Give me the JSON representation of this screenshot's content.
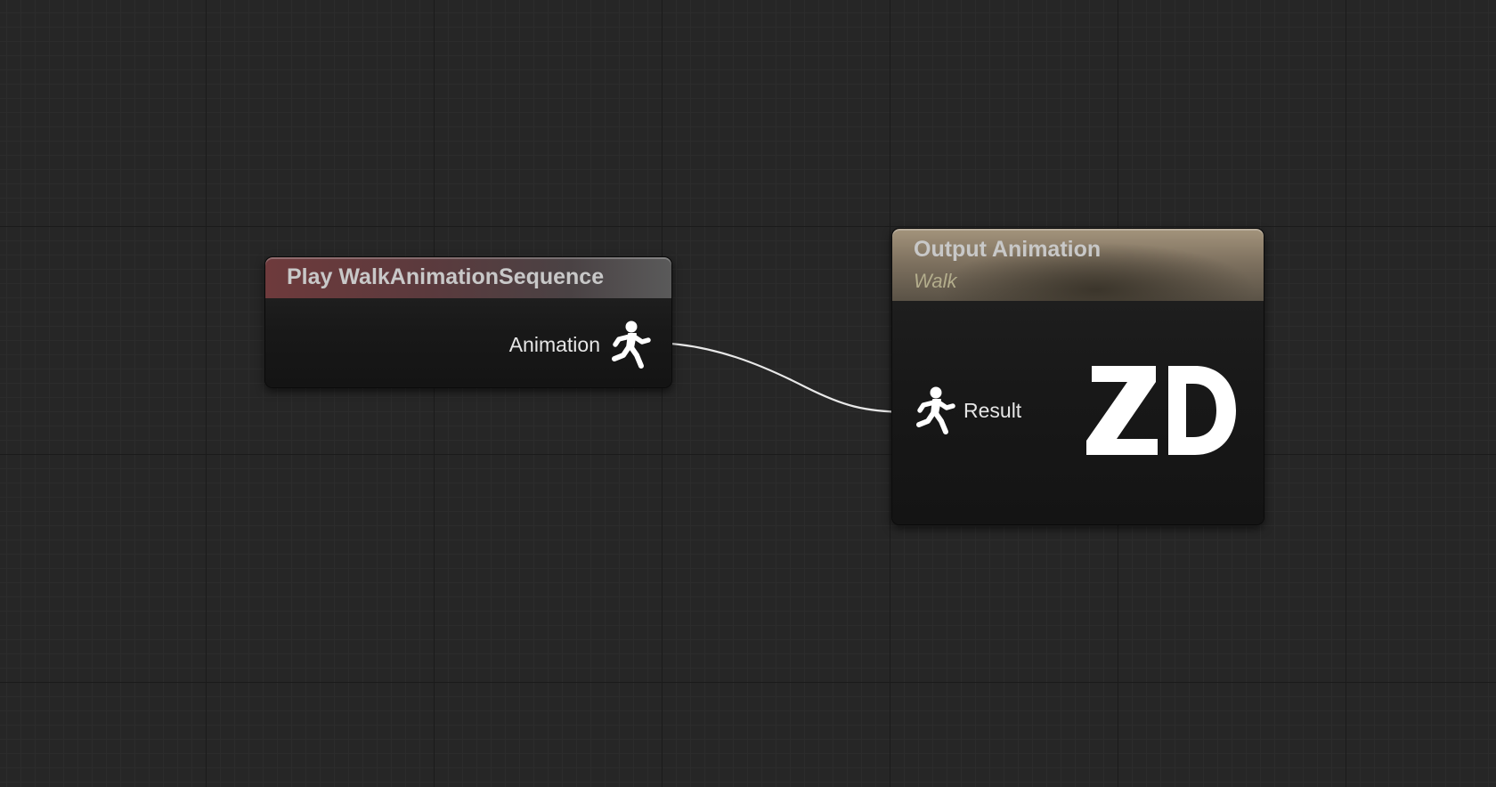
{
  "graph": {
    "nodes": {
      "play": {
        "title": "Play WalkAnimationSequence",
        "output_pin_label": "Animation",
        "pin_icon": "running-man-icon"
      },
      "output": {
        "title": "Output Animation",
        "subtitle": "Walk",
        "input_pin_label": "Result",
        "pin_icon": "running-man-icon",
        "logo_text": "ZD"
      }
    },
    "connection": {
      "from": "Animation",
      "to": "Result",
      "color": "#e8e8e8"
    },
    "colors": {
      "background": "#262626",
      "play_header": "#6e3a3c",
      "output_header": "#a4947c",
      "subtitle": "#b3ad8c"
    }
  }
}
